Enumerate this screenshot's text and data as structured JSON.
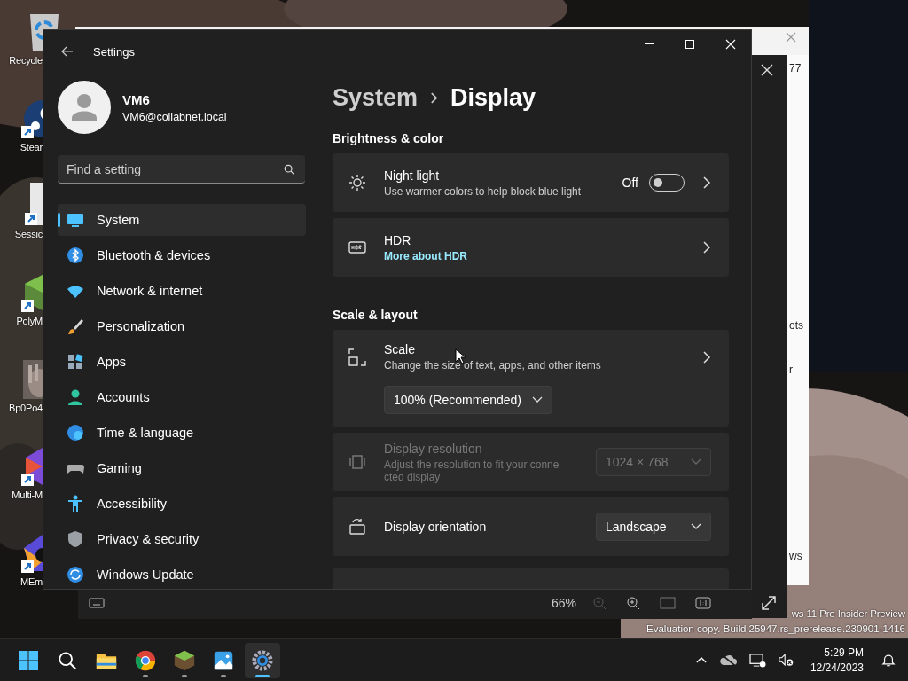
{
  "desktop_icons": [
    {
      "label": "Recycle",
      "kind": "bin",
      "shortcut": false
    },
    {
      "label": "Stear",
      "kind": "steam",
      "shortcut": true
    },
    {
      "label": "Sessic",
      "kind": "page",
      "shortcut": true
    },
    {
      "label": "PolyM",
      "kind": "cube",
      "shortcut": true
    },
    {
      "label": "Bp0Po4",
      "shortcut": false
    },
    {
      "label": "Multi-M",
      "kind": "hex",
      "shortcut": true
    },
    {
      "label": "MEm",
      "kind": "pentagon",
      "shortcut": true
    }
  ],
  "background_window": {
    "fragments": [
      "77",
      "ots",
      "r",
      "ws"
    ]
  },
  "viewer_toolbar": {
    "zoom": "66%"
  },
  "settings": {
    "title": "Settings",
    "user": {
      "name": "VM6",
      "email": "VM6@collabnet.local"
    },
    "search": {
      "placeholder": "Find a setting"
    },
    "nav": [
      {
        "label": "System",
        "kind": "system",
        "selected": true
      },
      {
        "label": "Bluetooth & devices",
        "kind": "bluetooth",
        "selected": false
      },
      {
        "label": "Network & internet",
        "kind": "network",
        "selected": false
      },
      {
        "label": "Personalization",
        "kind": "brush",
        "selected": false
      },
      {
        "label": "Apps",
        "kind": "apps",
        "selected": false
      },
      {
        "label": "Accounts",
        "kind": "accounts",
        "selected": false
      },
      {
        "label": "Time & language",
        "kind": "time",
        "selected": false
      },
      {
        "label": "Gaming",
        "kind": "gaming",
        "selected": false
      },
      {
        "label": "Accessibility",
        "kind": "accessibility",
        "selected": false
      },
      {
        "label": "Privacy & security",
        "kind": "privacy",
        "selected": false
      },
      {
        "label": "Windows Update",
        "kind": "update",
        "selected": false
      }
    ],
    "breadcrumb": [
      "System",
      "Display"
    ],
    "sections": [
      {
        "heading": "Brightness & color",
        "rows": [
          {
            "kind": "toggle",
            "title": "Night light",
            "subtitle": "Use warmer colors to help block blue light",
            "value": "Off",
            "on": false
          },
          {
            "kind": "link",
            "title": "HDR",
            "link": "More about HDR"
          }
        ]
      },
      {
        "heading": "Scale & layout",
        "rows": [
          {
            "kind": "dropdown-below",
            "title": "Scale",
            "subtitle": "Change the size of text, apps, and other items",
            "value": "100% (Recommended)"
          },
          {
            "kind": "dropdown",
            "title": "Display resolution",
            "subtitle": "Adjust the resolution to fit your connected display",
            "value": "1024 × 768",
            "disabled": true
          },
          {
            "kind": "dropdown",
            "title": "Display orientation",
            "value": "Landscape",
            "disabled": false
          }
        ]
      }
    ]
  },
  "watermark": [
    "ws 11 Pro Insider Preview",
    "Evaluation copy. Build 25947.rs_prerelease.230901-1416"
  ],
  "taskbar": {
    "apps": [
      {
        "kind": "folder",
        "running": false,
        "selected": false
      },
      {
        "kind": "chrome",
        "running": true,
        "selected": false
      },
      {
        "kind": "cube",
        "running": true,
        "selected": false
      },
      {
        "kind": "photos",
        "running": true,
        "selected": false
      },
      {
        "kind": "gear",
        "running": true,
        "selected": true
      }
    ],
    "time": "5:29 PM",
    "date": "12/24/2023"
  }
}
